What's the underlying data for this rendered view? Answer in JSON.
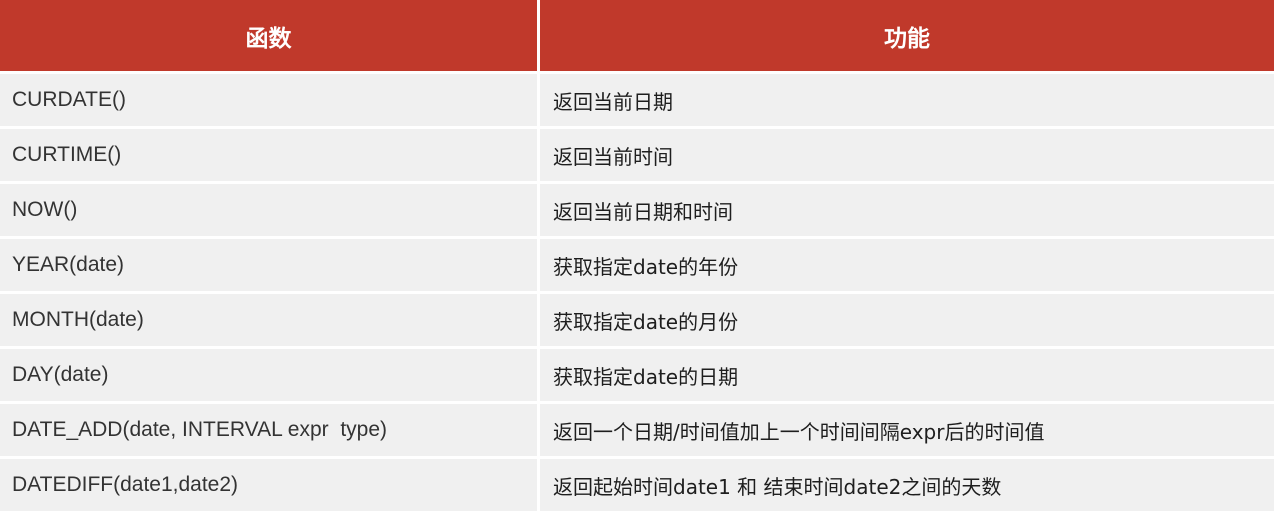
{
  "header": {
    "col1": "函数",
    "col2": "功能"
  },
  "rows": [
    {
      "function": "CURDATE()",
      "description": "返回当前日期"
    },
    {
      "function": "CURTIME()",
      "description": "返回当前时间"
    },
    {
      "function": "NOW()",
      "description": "返回当前日期和时间"
    },
    {
      "function": "YEAR(date)",
      "description": "获取指定date的年份"
    },
    {
      "function": "MONTH(date)",
      "description": "获取指定date的月份"
    },
    {
      "function": "DAY(date)",
      "description": "获取指定date的日期"
    },
    {
      "function": "DATE_ADD(date, INTERVAL expr  type)",
      "description": "返回一个日期/时间值加上一个时间间隔expr后的时间值"
    },
    {
      "function": "DATEDIFF(date1,date2)",
      "description": "返回起始时间date1 和 结束时间date2之间的天数"
    }
  ],
  "colors": {
    "header_bg": "#c0392b",
    "header_text": "#ffffff",
    "row_bg": "#f0f0f0"
  }
}
